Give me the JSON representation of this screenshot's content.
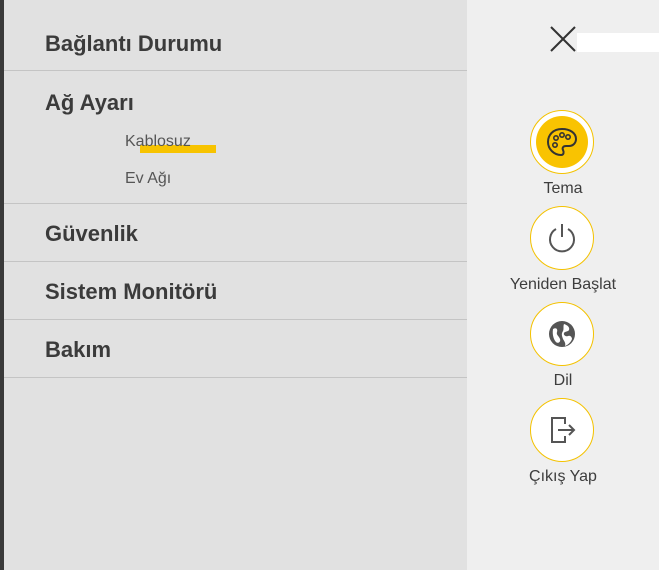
{
  "menu": {
    "sections": [
      {
        "title": "Bağlantı Durumu"
      },
      {
        "title": "Ağ Ayarı",
        "items": [
          "Kablosuz",
          "Ev Ağı"
        ]
      },
      {
        "title": "Güvenlik"
      },
      {
        "title": "Sistem Monitörü"
      },
      {
        "title": "Bakım"
      }
    ]
  },
  "actions": {
    "theme": "Tema",
    "restart": "Yeniden Başlat",
    "language": "Dil",
    "logout": "Çıkış Yap"
  },
  "colors": {
    "accent": "#f9c301",
    "panel": "#e1e1e1",
    "side": "#efefef",
    "text": "#3b3b3b"
  }
}
